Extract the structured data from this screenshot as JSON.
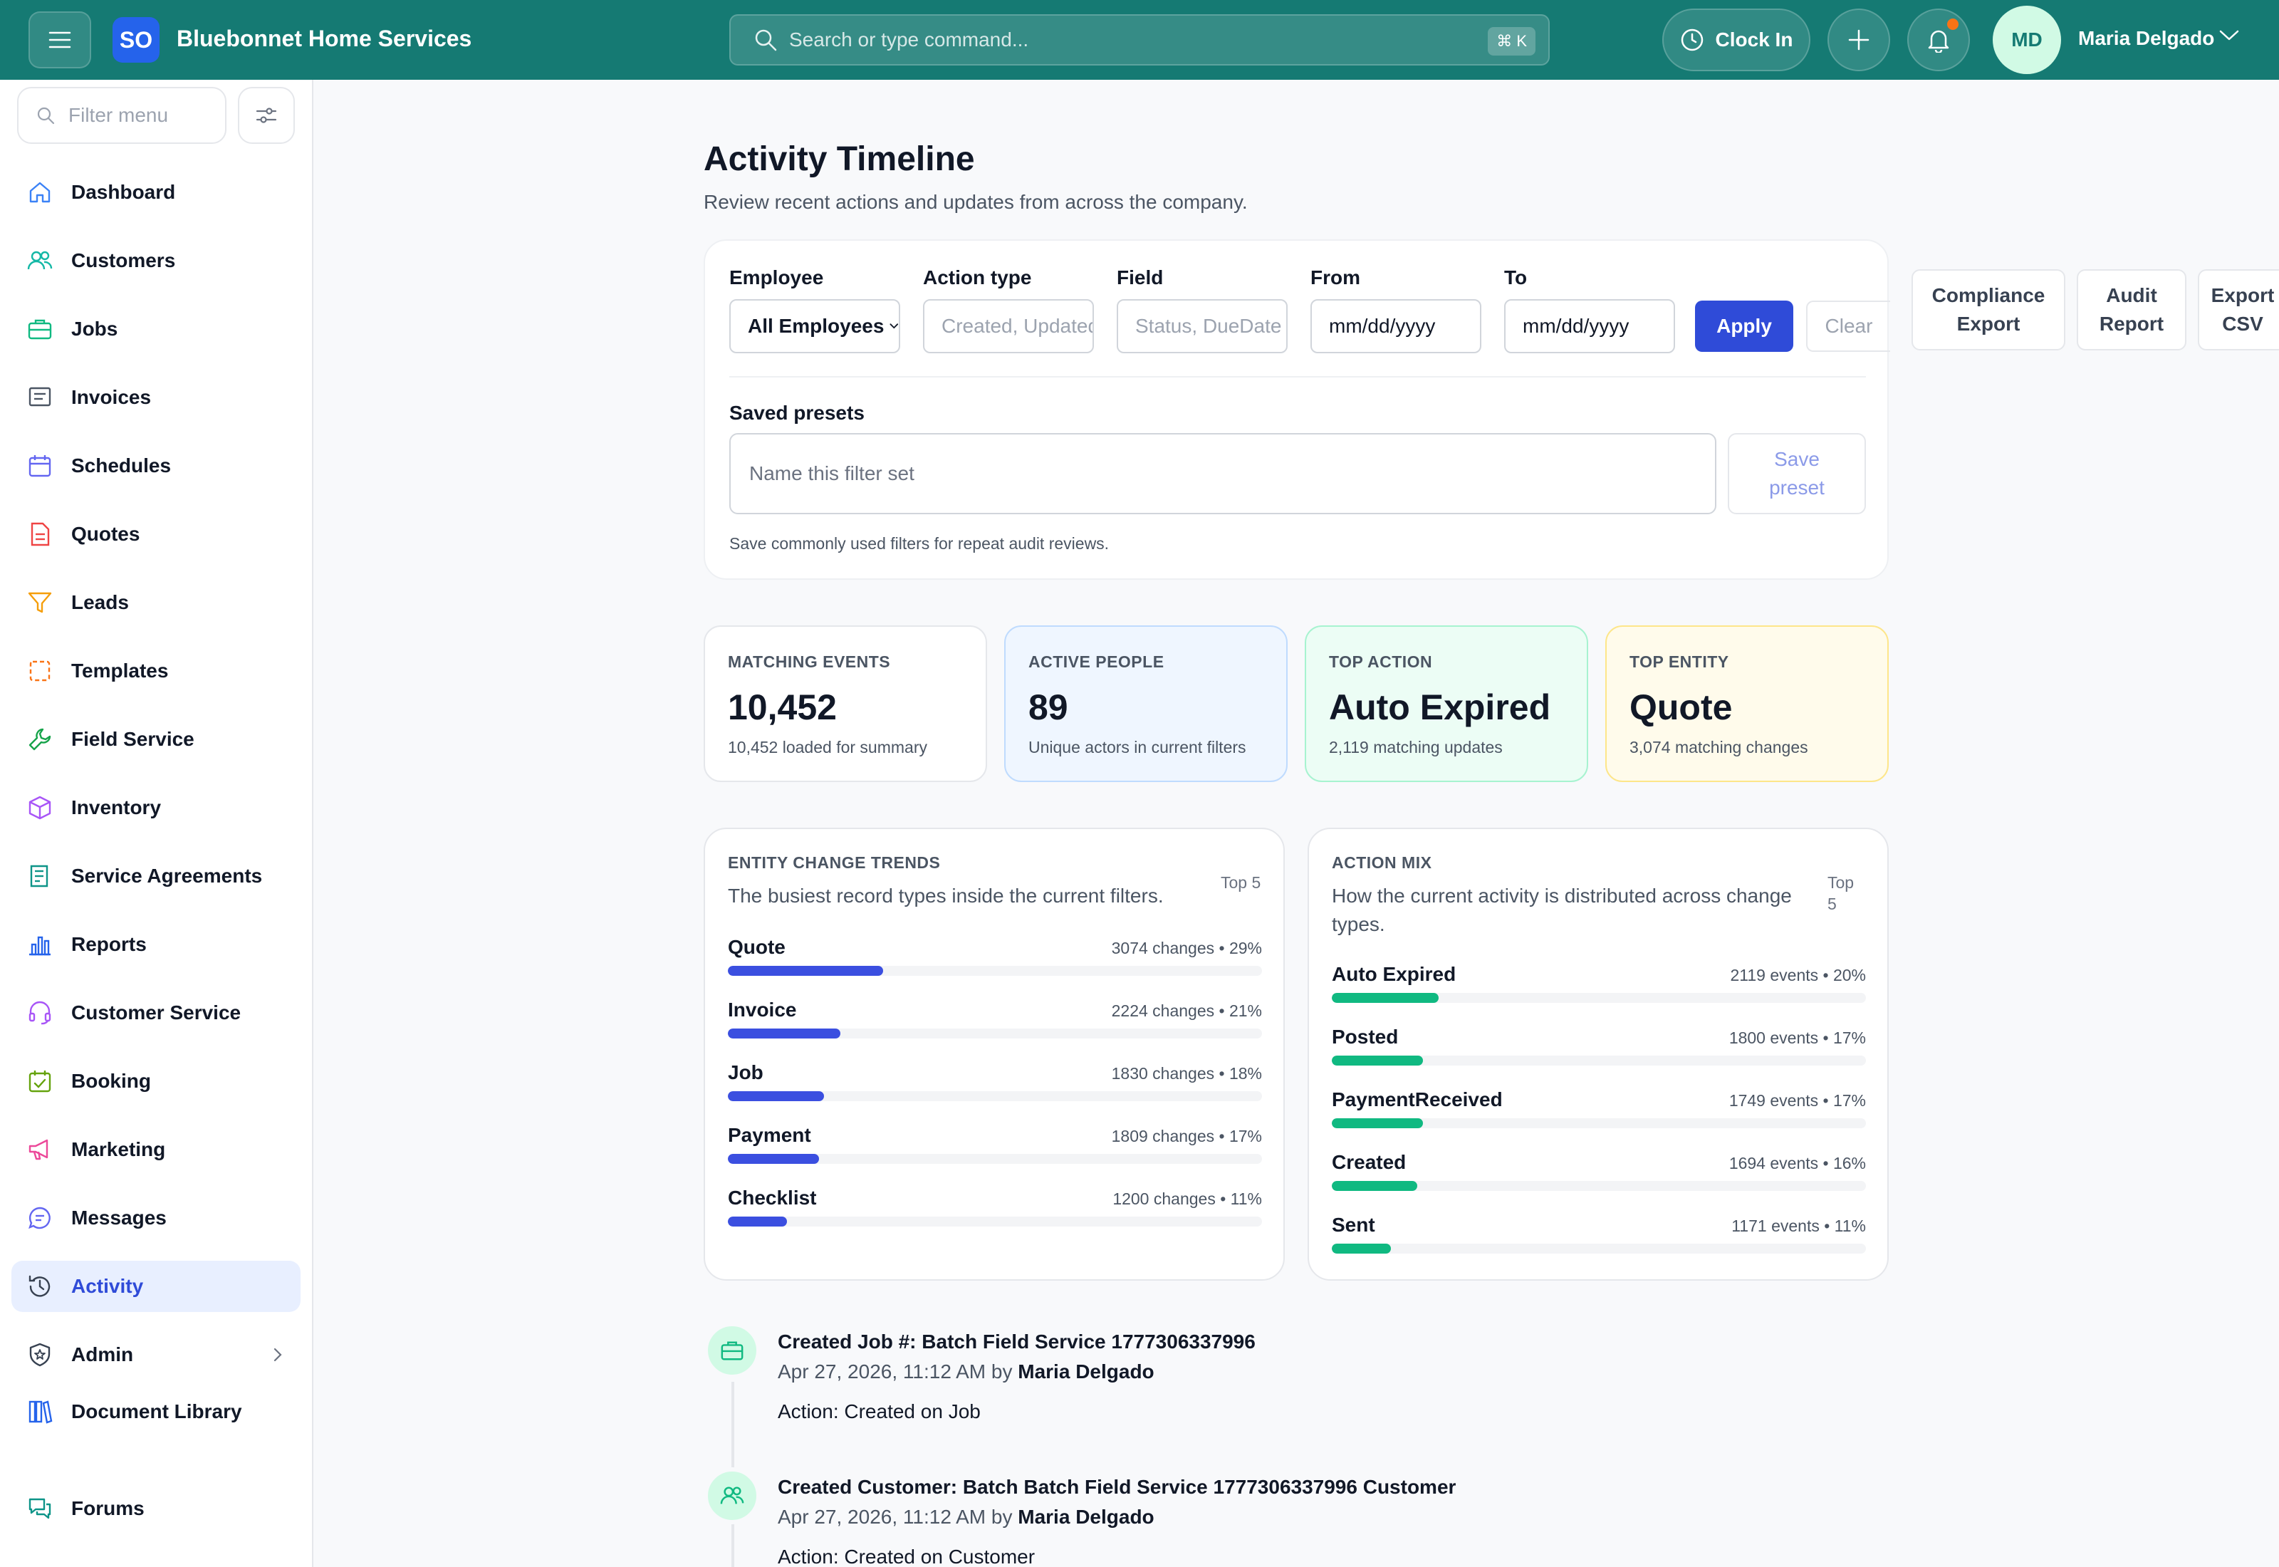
{
  "header": {
    "logo_text": "SO",
    "company": "Bluebonnet Home Services",
    "search_placeholder": "Search or type command...",
    "search_shortcut": "⌘ K",
    "clock_in": "Clock In",
    "user_initials": "MD",
    "user_name": "Maria Delgado",
    "accent": "#157a73"
  },
  "sidebar": {
    "filter_placeholder": "Filter menu",
    "items": [
      {
        "label": "Dashboard",
        "icon": "home-icon"
      },
      {
        "label": "Customers",
        "icon": "users-icon"
      },
      {
        "label": "Jobs",
        "icon": "briefcase-icon"
      },
      {
        "label": "Invoices",
        "icon": "invoice-icon"
      },
      {
        "label": "Schedules",
        "icon": "calendar-icon"
      },
      {
        "label": "Quotes",
        "icon": "document-icon"
      },
      {
        "label": "Leads",
        "icon": "funnel-icon"
      },
      {
        "label": "Templates",
        "icon": "template-icon"
      },
      {
        "label": "Field Service",
        "icon": "wrench-icon"
      },
      {
        "label": "Inventory",
        "icon": "box-icon"
      },
      {
        "label": "Service Agreements",
        "icon": "agreement-icon"
      },
      {
        "label": "Reports",
        "icon": "bar-chart-icon"
      },
      {
        "label": "Customer Service",
        "icon": "headset-icon"
      },
      {
        "label": "Booking",
        "icon": "calendar-check-icon"
      },
      {
        "label": "Marketing",
        "icon": "megaphone-icon"
      },
      {
        "label": "Messages",
        "icon": "chat-icon"
      },
      {
        "label": "Activity",
        "icon": "history-icon"
      },
      {
        "label": "Admin",
        "icon": "shield-icon"
      },
      {
        "label": "Document Library",
        "icon": "library-icon"
      },
      {
        "label": "Forums",
        "icon": "forum-icon"
      }
    ]
  },
  "main": {
    "title": "Activity Timeline",
    "subtitle": "Review recent actions and updates from across the company."
  },
  "filters": {
    "employee_label": "Employee",
    "employee_value": "All Employees",
    "action_label": "Action type",
    "action_placeholder": "Created, Updated",
    "field_label": "Field",
    "field_placeholder": "Status, DueDate",
    "from_label": "From",
    "from_value": "mm/dd/yyyy",
    "to_label": "To",
    "to_value": "mm/dd/yyyy",
    "apply": "Apply",
    "clear": "Clear",
    "presets_label": "Saved presets",
    "preset_placeholder": "Name this filter set",
    "save_preset": "Save preset",
    "preset_help": "Save commonly used filters for repeat audit reviews.",
    "compliance_export": "Compliance Export",
    "audit_report": "Audit Report",
    "export_csv": "Export CSV"
  },
  "stats": [
    {
      "title": "MATCHING EVENTS",
      "value": "10,452",
      "sub": "10,452 loaded for summary"
    },
    {
      "title": "ACTIVE PEOPLE",
      "value": "89",
      "sub": "Unique actors in current filters"
    },
    {
      "title": "TOP ACTION",
      "value": "Auto Expired",
      "sub": "2,119 matching updates"
    },
    {
      "title": "TOP ENTITY",
      "value": "Quote",
      "sub": "3,074 matching changes"
    }
  ],
  "entity_trends": {
    "title": "ENTITY CHANGE TRENDS",
    "subtitle": "The busiest record types inside the current filters.",
    "top": "Top 5",
    "color": "#3b4fe0",
    "rows": [
      {
        "name": "Quote",
        "meta": "3074 changes • 29%",
        "pct": 29
      },
      {
        "name": "Invoice",
        "meta": "2224 changes • 21%",
        "pct": 21
      },
      {
        "name": "Job",
        "meta": "1830 changes • 18%",
        "pct": 18
      },
      {
        "name": "Payment",
        "meta": "1809 changes • 17%",
        "pct": 17
      },
      {
        "name": "Checklist",
        "meta": "1200 changes • 11%",
        "pct": 11
      }
    ]
  },
  "action_mix": {
    "title": "ACTION MIX",
    "subtitle": "How the current activity is distributed across change types.",
    "top": "Top 5",
    "color": "#10b981",
    "rows": [
      {
        "name": "Auto Expired",
        "meta": "2119 events • 20%",
        "pct": 20
      },
      {
        "name": "Posted",
        "meta": "1800 events • 17%",
        "pct": 17
      },
      {
        "name": "PaymentReceived",
        "meta": "1749 events • 17%",
        "pct": 17
      },
      {
        "name": "Created",
        "meta": "1694 events • 16%",
        "pct": 16
      },
      {
        "name": "Sent",
        "meta": "1171 events • 11%",
        "pct": 11
      }
    ]
  },
  "timeline": [
    {
      "icon": "briefcase-icon",
      "title": "Created Job #: Batch Field Service 1777306337996",
      "date": "Apr 27, 2026, 11:12 AM by",
      "user": "Maria Delgado",
      "action": "Action: Created on Job"
    },
    {
      "icon": "users-icon",
      "title": "Created Customer: Batch Batch Field Service 1777306337996 Customer",
      "date": "Apr 27, 2026, 11:12 AM by",
      "user": "Maria Delgado",
      "action": "Action: Created on Customer"
    }
  ]
}
